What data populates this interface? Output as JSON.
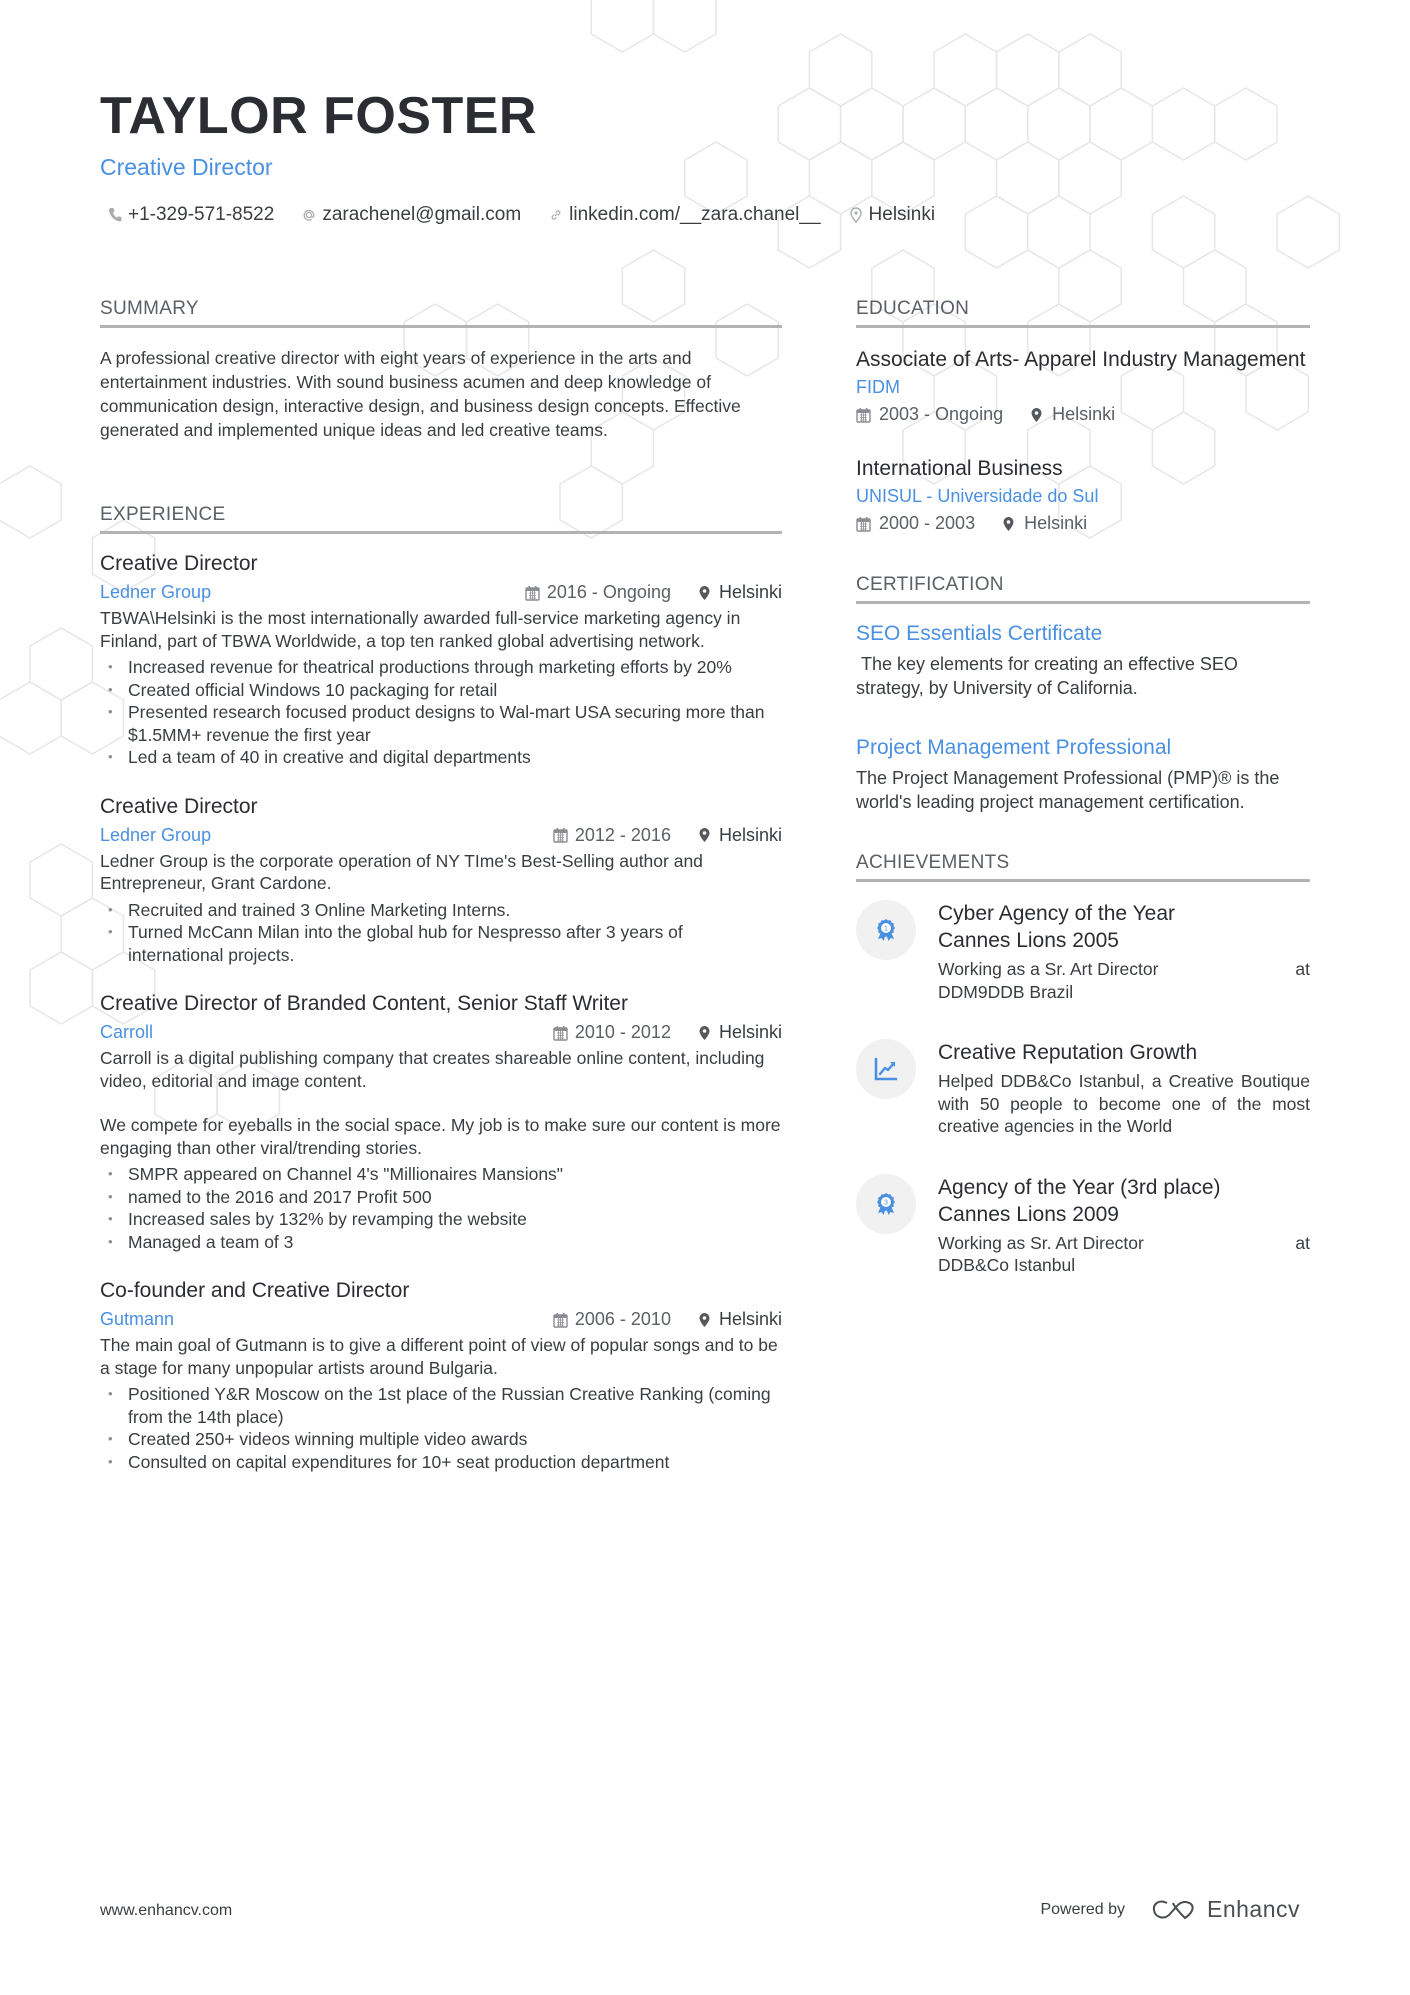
{
  "header": {
    "name": "TAYLOR FOSTER",
    "headline": "Creative Director",
    "contacts": [
      {
        "icon": "phone-icon",
        "value": "+1-329-571-8522"
      },
      {
        "icon": "at-icon",
        "value": "zarachenel@gmail.com"
      },
      {
        "icon": "link-icon",
        "value": "linkedin.com/__zara.chanel__"
      },
      {
        "icon": "location-pin-icon",
        "value": "Helsinki"
      }
    ]
  },
  "summary": {
    "title": "SUMMARY",
    "text": "A professional creative director with eight years of experience in the arts and entertainment industries. With sound business acumen and deep knowledge of communication design, interactive design, and business design concepts. Effective generated and implemented unique ideas and led creative teams."
  },
  "experience": {
    "title": "EXPERIENCE",
    "items": [
      {
        "role": "Creative Director",
        "company": "Ledner Group",
        "dates": "2016 - Ongoing",
        "location": "Helsinki",
        "description": [
          "TBWA\\Helsinki is the most internationally awarded full-service marketing agency in Finland, part of TBWA Worldwide, a top ten ranked global advertising network."
        ],
        "bullets": [
          "Increased revenue for theatrical productions through marketing efforts by 20%",
          "Created official Windows 10 packaging for retail",
          "Presented research focused product designs to Wal-mart USA securing more than $1.5MM+ revenue the first year",
          "Led a team of 40 in creative and digital departments"
        ]
      },
      {
        "role": "Creative Director",
        "company": "Ledner Group",
        "dates": "2012 - 2016",
        "location": "Helsinki",
        "description": [
          "Ledner Group is the corporate operation of NY TIme's Best-Selling author and Entrepreneur, Grant Cardone."
        ],
        "bullets": [
          "Recruited and trained 3 Online Marketing Interns.",
          "Turned McCann Milan into the global hub for Nespresso after 3 years of international projects."
        ]
      },
      {
        "role": "Creative Director of Branded Content, Senior Staff Writer",
        "company": "Carroll",
        "dates": "2010 - 2012",
        "location": "Helsinki",
        "description": [
          "Carroll is a digital publishing company that creates shareable online content, including video, editorial and image content.",
          "We compete for eyeballs in the social space. My job is to make sure our content is more engaging than other viral/trending stories."
        ],
        "bullets": [
          "SMPR appeared on Channel 4's \"Millionaires Mansions\"",
          "named to the 2016 and 2017 Profit 500",
          "Increased sales by 132% by revamping the website",
          "Managed a team of 3"
        ]
      },
      {
        "role": "Co-founder and Creative Director",
        "company": "Gutmann",
        "dates": "2006 - 2010",
        "location": "Helsinki",
        "description": [
          "The main goal of Gutmann is to give a different point of view of popular songs and to be a stage for many unpopular artists around Bulgaria."
        ],
        "bullets": [
          "Positioned Y&R Moscow on the 1st place of the Russian Creative Ranking (coming from the 14th place)",
          "Created 250+ videos winning multiple video awards",
          "Consulted on capital expenditures for 10+ seat production department"
        ]
      }
    ]
  },
  "education": {
    "title": "EDUCATION",
    "items": [
      {
        "degree": "Associate of Arts- Apparel Industry Management",
        "school": "FIDM",
        "dates": "2003 - Ongoing",
        "location": "Helsinki"
      },
      {
        "degree": "International Business",
        "school": "UNISUL - Universidade do Sul",
        "dates": "2000 - 2003",
        "location": "Helsinki"
      }
    ]
  },
  "certification": {
    "title": "CERTIFICATION",
    "items": [
      {
        "name": "SEO Essentials Certificate",
        "description": " The key elements for creating an effective SEO strategy, by University of California."
      },
      {
        "name": "Project Management Professional",
        "description": "The Project Management Professional (PMP)® is the world's leading project management certification."
      }
    ]
  },
  "achievements": {
    "title": "ACHIEVEMENTS",
    "items": [
      {
        "icon": "award-ribbon-icon",
        "badge": "1",
        "title": "Cyber Agency of the Year Cannes Lions 2005",
        "description": "Working as a Sr. Art Director at DDM9DDB Brazil"
      },
      {
        "icon": "growth-chart-icon",
        "badge": "",
        "title": "Creative Reputation Growth",
        "description": "Helped DDB&Co Istanbul, a Creative Boutique with 50 people to become one of the most creative agencies in the World"
      },
      {
        "icon": "award-ribbon-icon",
        "badge": "3",
        "title": "Agency of the Year (3rd place) Cannes Lions 2009",
        "description": "Working as Sr. Art Director at DDB&Co Istanbul"
      }
    ]
  },
  "footer": {
    "website": "www.enhancv.com",
    "powered_by": "Powered by",
    "brand": "Enhancv"
  },
  "colors": {
    "accent": "#4a90e2",
    "text": "#2b2d33",
    "muted": "#5b5f66",
    "rule": "#b3b3b3",
    "hexagon": "#e6e6e6"
  }
}
